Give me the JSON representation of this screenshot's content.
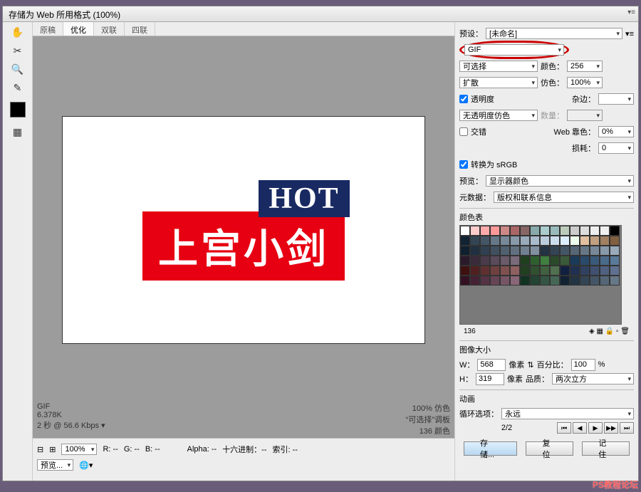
{
  "window": {
    "title": "存储为 Web 所用格式 (100%)"
  },
  "tabs": {
    "t0": "原稿",
    "t1": "优化",
    "t2": "双联",
    "t3": "四联"
  },
  "canvas": {
    "hot": "HOT",
    "banner": "上宫小剑"
  },
  "statusL": {
    "fmt": "GIF",
    "size": "6.378K",
    "time": "2 秒 @ 56.6 Kbps  ▾"
  },
  "statusR": {
    "l1": "100% 仿色",
    "l2": "“可选择”调板",
    "l3": "136 颜色"
  },
  "bottom": {
    "zoom": "100%",
    "r": "R: --",
    "g": "G: --",
    "b": "B: --",
    "alpha": "Alpha: --",
    "hex": "十六进制：--",
    "idx": "索引: --",
    "preview": "预览..."
  },
  "preset": {
    "label": "预设：",
    "value": "[未命名]"
  },
  "format": "GIF",
  "selectable": {
    "label": "可选择",
    "colors_lbl": "颜色：",
    "colors_val": "256"
  },
  "dither": {
    "method": "扩散",
    "label": "仿色：",
    "value": "100%"
  },
  "transparency": {
    "label": "透明度",
    "matte_lbl": "杂边：",
    "matte_val": ""
  },
  "notransdither": {
    "label": "无透明度仿色",
    "amount_lbl": "数量：",
    "amount_val": ""
  },
  "interlace": {
    "label": "交错",
    "web_lbl": "Web 靠色：",
    "web_val": "0%"
  },
  "lossy": {
    "label": "损耗：",
    "value": "0"
  },
  "srgb": {
    "label": "转换为 sRGB"
  },
  "previewrow": {
    "label": "预览：",
    "value": "显示器颜色"
  },
  "meta": {
    "label": "元数据：",
    "value": "版权和联系信息"
  },
  "colortable": {
    "title": "颜色表",
    "count": "136"
  },
  "imagesize": {
    "title": "图像大小",
    "w": "568",
    "h": "319",
    "unit": "像素",
    "percent_lbl": "百分比：",
    "percent": "100",
    "pctunit": "%",
    "quality_lbl": "品质：",
    "quality": "两次立方"
  },
  "anim": {
    "title": "动画",
    "loop_lbl": "循环选项：",
    "loop_val": "永远",
    "frames": "2/2"
  },
  "footer": {
    "save": "存储...",
    "cancel": "复位",
    "remember": "记住"
  },
  "watermark": "PS教程论坛"
}
